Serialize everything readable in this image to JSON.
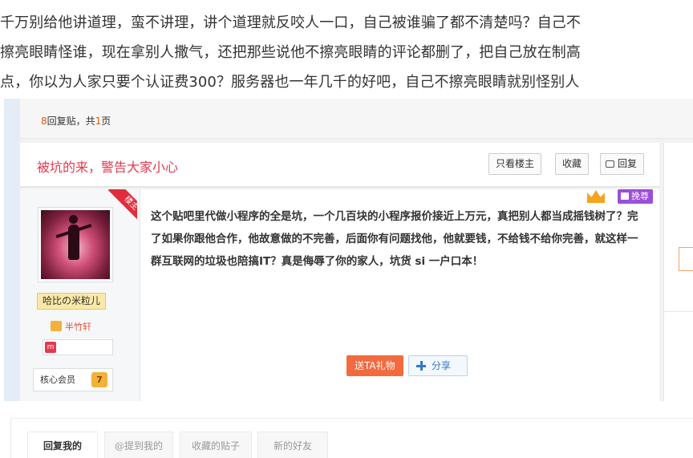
{
  "article": {
    "line1": "千万别给他讲道理，蛮不讲理，讲个道理就反咬人一口，自己被谁骗了都不清楚吗？自己不",
    "line2": "擦亮眼睛怪谁，现在拿别人撒气，还把那些说他不擦亮眼睛的评论都删了，把自己放在制高",
    "line3": "点，你以为人家只要个认证费300？服务器也一年几千的好吧，自己不擦亮眼睛就别怪别人"
  },
  "forum": {
    "pager": {
      "count": "8",
      "mid": "回复贴，共",
      "pages": "1",
      "suffix": "页"
    },
    "thread_title": "被坑的来，警告大家小心",
    "buttons": {
      "only_op": "只看楼主",
      "favorite": "收藏",
      "reply": "回复"
    },
    "op_badge": "楼主",
    "author": {
      "name": "哈比の米粒儿",
      "honor": "半竹轩",
      "member_label": "核心会员",
      "level": "7"
    },
    "post": {
      "body": "这个贴吧里代做小程序的全是坑，一个几百块的小程序报价接近上万元，真把别人都当成摇钱树了？完了如果你跟他合作，他故意做的不完善，后面你有问题找他，他就要钱，不给钱不给你完善，就这样一群互联网的垃圾也陪搞IT？真是侮辱了你的家人，坑货 si 一户口本！",
      "tag": "挽尊",
      "gift_button": "送TA礼物",
      "share_button": "分享"
    },
    "icons": {
      "reply": "speech-bubble-icon",
      "crown": "crown-icon",
      "share": "plus-icon",
      "honor": "badge-icon",
      "member": "member-icon"
    },
    "colors": {
      "title_red": "#e4394e",
      "gift_orange": "#f26a3d",
      "tag_purple": "#9b4fd8",
      "share_blue": "#3477c4"
    }
  },
  "tabs": [
    {
      "label": "回复我的",
      "active": true
    },
    {
      "label": "@提到我的",
      "active": false
    },
    {
      "label": "收藏的贴子",
      "active": false
    },
    {
      "label": "新的好友",
      "active": false
    }
  ]
}
